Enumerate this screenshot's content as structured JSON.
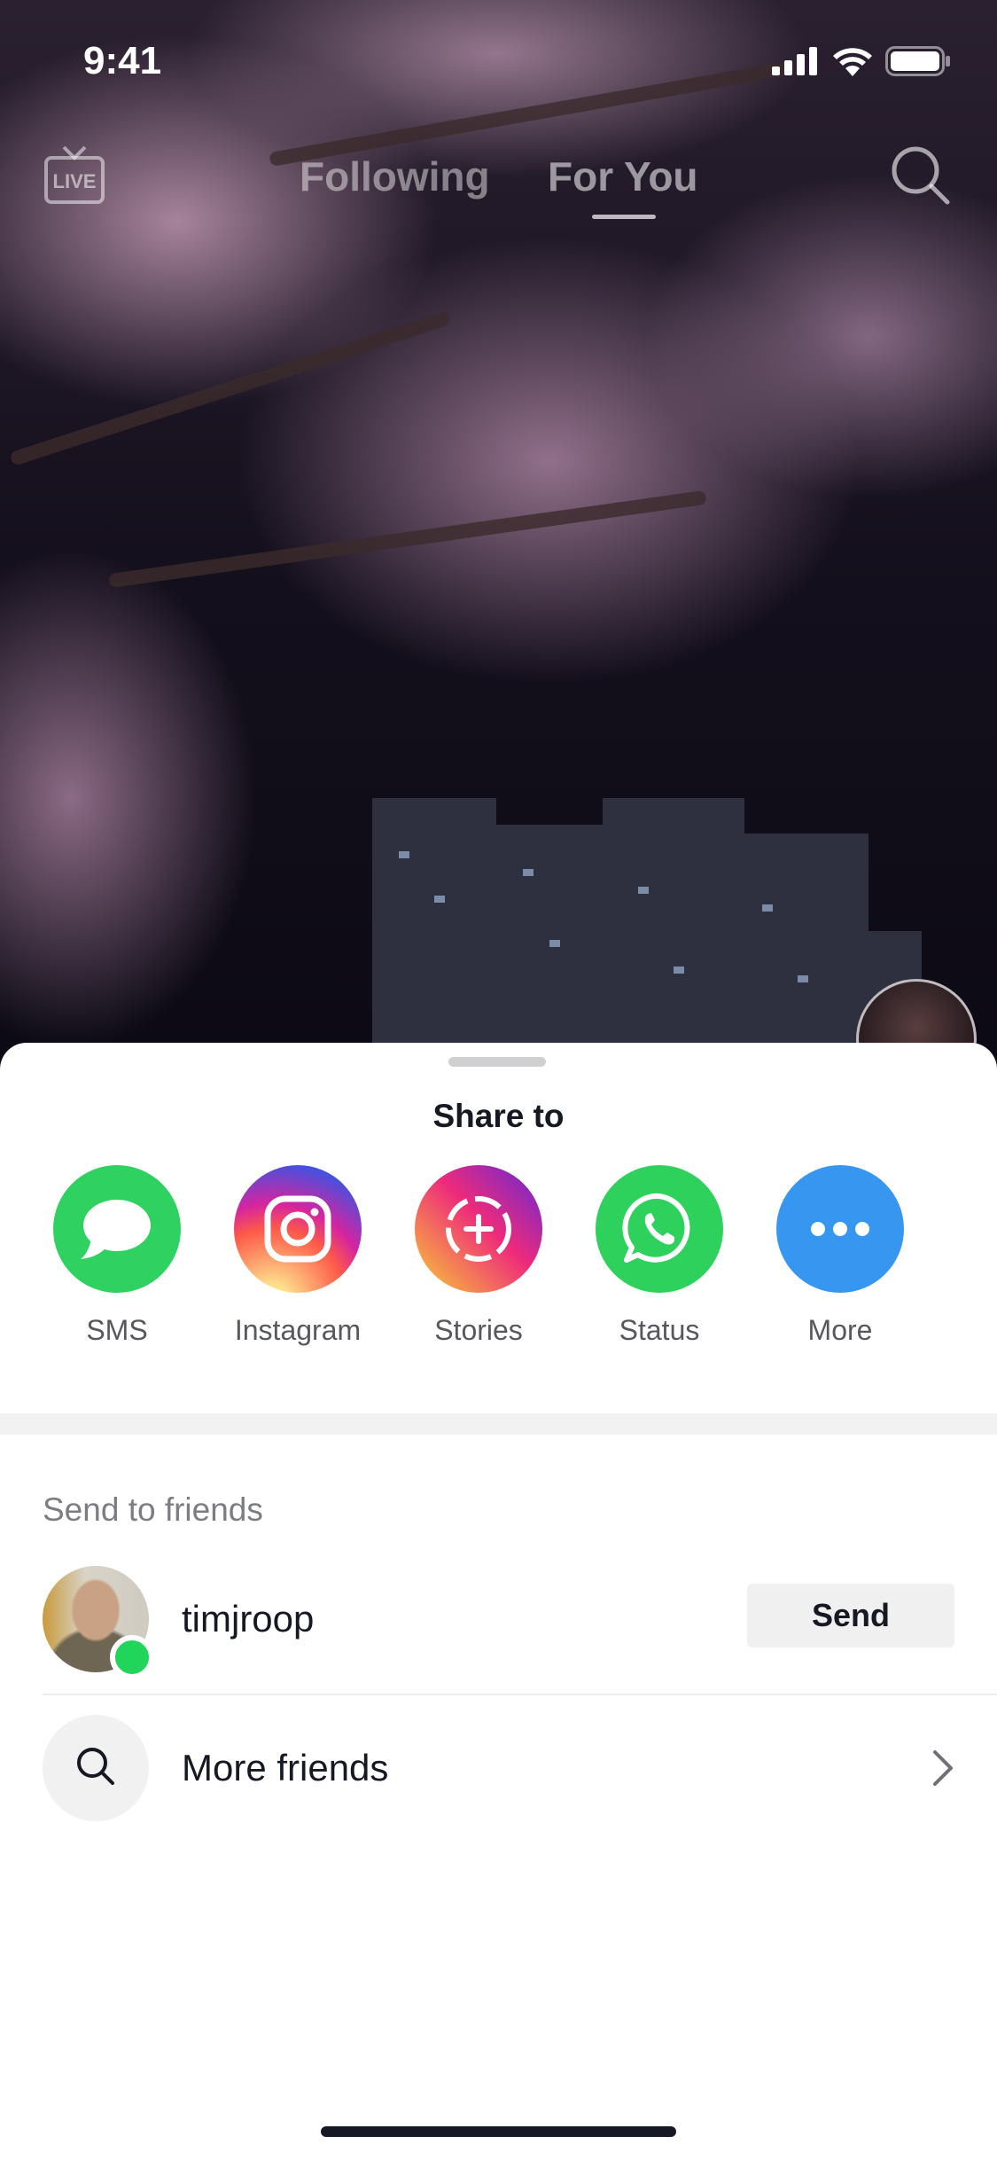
{
  "status_bar": {
    "time": "9:41"
  },
  "top_nav": {
    "live_label": "LIVE",
    "tabs": [
      {
        "label": "Following",
        "active": false
      },
      {
        "label": "For You",
        "active": true
      }
    ]
  },
  "share_sheet": {
    "title": "Share to",
    "targets": [
      {
        "label": "SMS",
        "icon": "message-bubble-icon",
        "color": "#2fd160"
      },
      {
        "label": "Instagram",
        "icon": "instagram-icon",
        "color": "#d6249f"
      },
      {
        "label": "Stories",
        "icon": "instagram-stories-icon",
        "color": "#ee2a7b"
      },
      {
        "label": "Status",
        "icon": "whatsapp-icon",
        "color": "#2ed15c"
      },
      {
        "label": "More",
        "icon": "more-dots-icon",
        "color": "#3797f0"
      }
    ],
    "send_to_friends": {
      "title": "Send to friends",
      "friends": [
        {
          "username": "timjroop",
          "online": true,
          "button_label": "Send"
        }
      ],
      "more_friends_label": "More friends"
    }
  },
  "colors": {
    "online": "#20d55a",
    "sheet_bg": "#ffffff",
    "text": "#161823"
  }
}
